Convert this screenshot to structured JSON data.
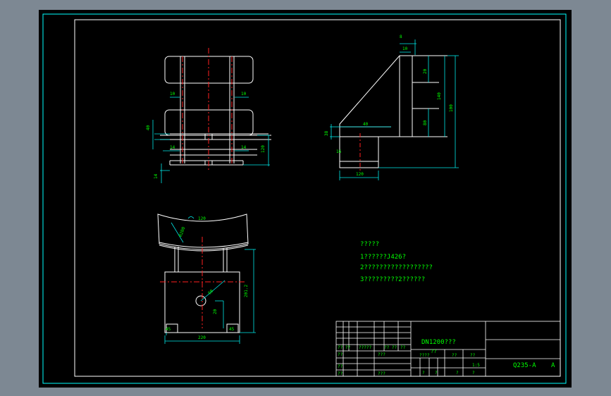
{
  "colors": {
    "background": "#000000",
    "window_frame": "#7d8893",
    "geometry": "#ffffff",
    "centerline": "#ff2020",
    "dimension": "#00e8e8",
    "dim_text": "#00ff00",
    "notes": "#00ff00",
    "frame_line": "#00ffff"
  },
  "dimensions": {
    "top_view": [
      "10",
      "10",
      "40",
      "14",
      "14",
      "120",
      "14"
    ],
    "side_view": [
      "8",
      "10",
      "20",
      "80",
      "140",
      "100",
      "38",
      "40",
      "120",
      "16"
    ],
    "bottom_view": [
      "120",
      "R200",
      "60",
      "20",
      "201.2",
      "45",
      "45",
      "220"
    ]
  },
  "notes": {
    "title": "?????",
    "line1": "1??????J426?",
    "line2": "2??????????????????",
    "line3": "3?????????2??????"
  },
  "title_block": {
    "drawing_name": "DN1200???",
    "sub_name": "??",
    "material": "Q235-A",
    "sheet_letter": "A",
    "scale": "1:5",
    "left_rows": [
      [
        "?? ??",
        "?????",
        "?? ??",
        "??"
      ],
      [
        "??",
        "???"
      ],
      [
        "??"
      ],
      [
        "??",
        "???"
      ]
    ],
    "mid_labels": [
      "????",
      "??",
      "??"
    ],
    "mid_bottom": [
      "?",
      "?",
      "?",
      "?"
    ]
  }
}
